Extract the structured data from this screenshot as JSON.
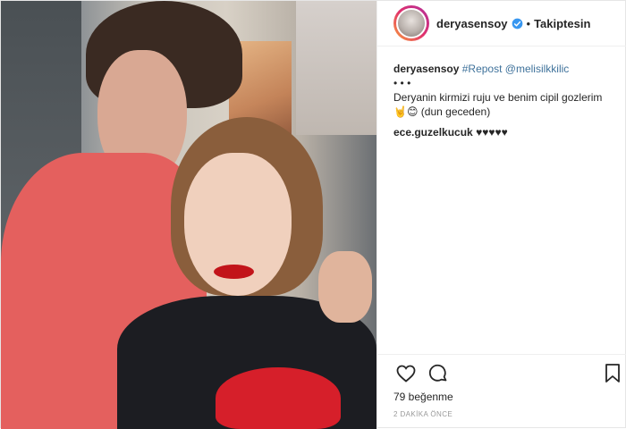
{
  "header": {
    "username": "deryasensoy",
    "separator": "•",
    "follow_status": "Takiptesin"
  },
  "caption": {
    "username": "deryasensoy",
    "hashtag": "#Repost",
    "mention": "@melisilkkilic",
    "dots": "• • •",
    "text_line1": "Deryanin kirmizi ruju ve benim cipil gozlerim",
    "emoji": "🤘😊",
    "text_line2": "(dun geceden)"
  },
  "comment": {
    "username": "ece.guzelkucuk",
    "text": "♥♥♥♥♥"
  },
  "likes": "79 beğenme",
  "timestamp": "2 DAKİKA ÖNCE",
  "icons": [
    "heart-icon",
    "comment-icon",
    "bookmark-icon",
    "verified-badge-icon"
  ]
}
